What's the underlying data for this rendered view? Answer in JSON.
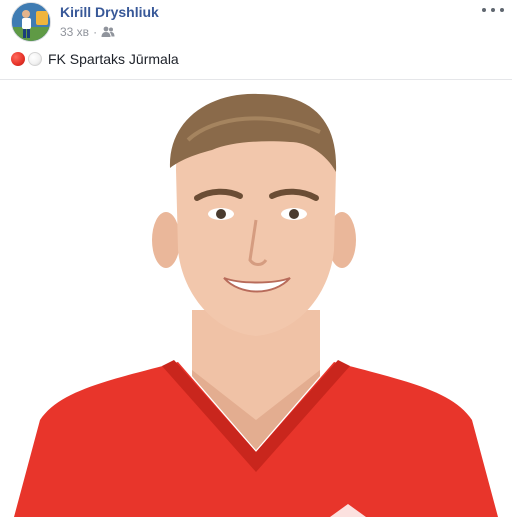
{
  "post": {
    "author": "Kirill Dryshliuk",
    "time": "33 хв",
    "separator": "·",
    "audience_icon": "friends-icon",
    "more_icon": "more-options-icon",
    "text_prefix_emoji": [
      "red-circle",
      "white-circle"
    ],
    "text": "FK Spartaks Jūrmala",
    "colors": {
      "author_link": "#385898",
      "meta": "#90949c",
      "jersey": "#e8352b",
      "emoji_red": "#e8352b"
    }
  }
}
